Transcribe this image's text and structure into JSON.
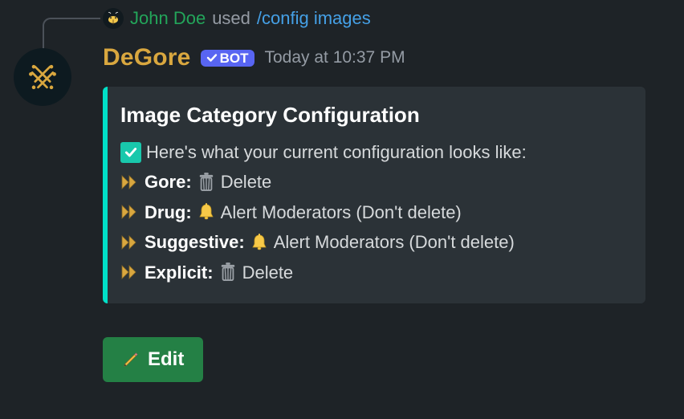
{
  "reply": {
    "invoker": "John Doe",
    "used": "used",
    "command": "/config images"
  },
  "header": {
    "bot_name": "DeGore",
    "bot_tag": "BOT",
    "timestamp": "Today at 10:37 PM"
  },
  "embed": {
    "accent_color": "#00e0c7",
    "title": "Image Category Configuration",
    "intro": "Here's what your current configuration looks like:",
    "rows": [
      {
        "label": "Gore:",
        "icon": "trash",
        "action": "Delete"
      },
      {
        "label": "Drug:",
        "icon": "bell",
        "action": "Alert Moderators (Don't delete)"
      },
      {
        "label": "Suggestive:",
        "icon": "bell",
        "action": "Alert Moderators (Don't delete)"
      },
      {
        "label": "Explicit:",
        "icon": "trash",
        "action": "Delete"
      }
    ]
  },
  "button": {
    "label": "Edit"
  }
}
